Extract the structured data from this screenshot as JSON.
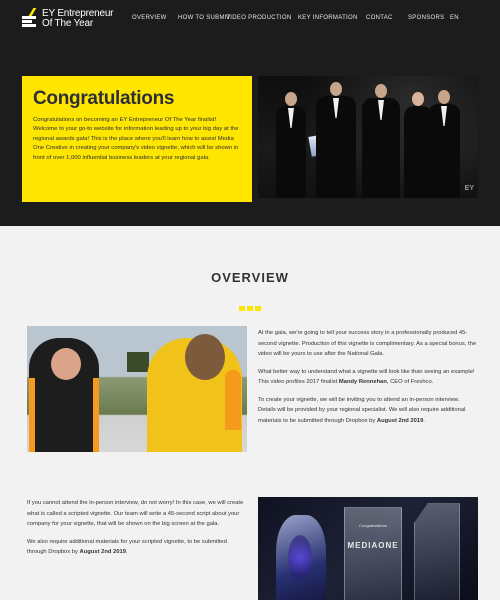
{
  "brand": {
    "logo_line1": "EY Entrepreneur",
    "logo_line2": "Of The Year",
    "accent_color": "#ffe600",
    "hero_bg": "#1c1c1c"
  },
  "nav": {
    "items": [
      {
        "label": "OVERVIEW"
      },
      {
        "label": "HOW TO SUBMIT"
      },
      {
        "label": "VIDEO PRODUCTION"
      },
      {
        "label": "KEY INFORMATION"
      },
      {
        "label": "CONTAC"
      },
      {
        "label": "SPONSORS"
      },
      {
        "label": "EN"
      }
    ]
  },
  "hero": {
    "title": "Congratulations",
    "body": "Congratulations on becoming an EY Entrepreneur Of The Year finalist! Welcome to your go-to website for information leading up to your big day at the regional awards gala! This is the place where you'll learn how to assist Media One Creative in creating your company's video vignette, which will be shown in front of over 1,000 influential business leaders at your regional gala.",
    "photo_watermark": "EY"
  },
  "overview": {
    "title": "OVERVIEW",
    "para1": "At the gala, we're going to tell your success story in a professionally produced 45-second vignette. Production of this vignette is complimentary. As a special bonus, the video will be yours to use after the National Gala.",
    "para2_prefix": "What better way to understand what a vignette will look like than seeing an example! This video profiles 2017 finalist ",
    "para2_name": "Mandy Rennehan",
    "para2_suffix": ", CEO of Freshco.",
    "para3_prefix": "To create your vignette, we will be inviting you to attend an in-person interview. Details will be provided by your regional specialist. We will also require additional materials to be submitted through Dropbox by ",
    "para3_date": "August 2nd 2019",
    "para3_suffix": ".",
    "para4": "If you cannot attend the in-person interview, do not worry! In this case, we will create what is called a scripted vignette. Our team will write a 45-second script about your company for your vignette, that will be shown on the big screen at the gala.",
    "para5_prefix": "We also require additional materials for your scripted vignette, to be submitted through Dropbox by ",
    "para5_date": "August 2nd 2019",
    "para5_suffix": "."
  },
  "awards_photo": {
    "label_small": "Congratulations",
    "label_brand": "MEDIAONE"
  }
}
